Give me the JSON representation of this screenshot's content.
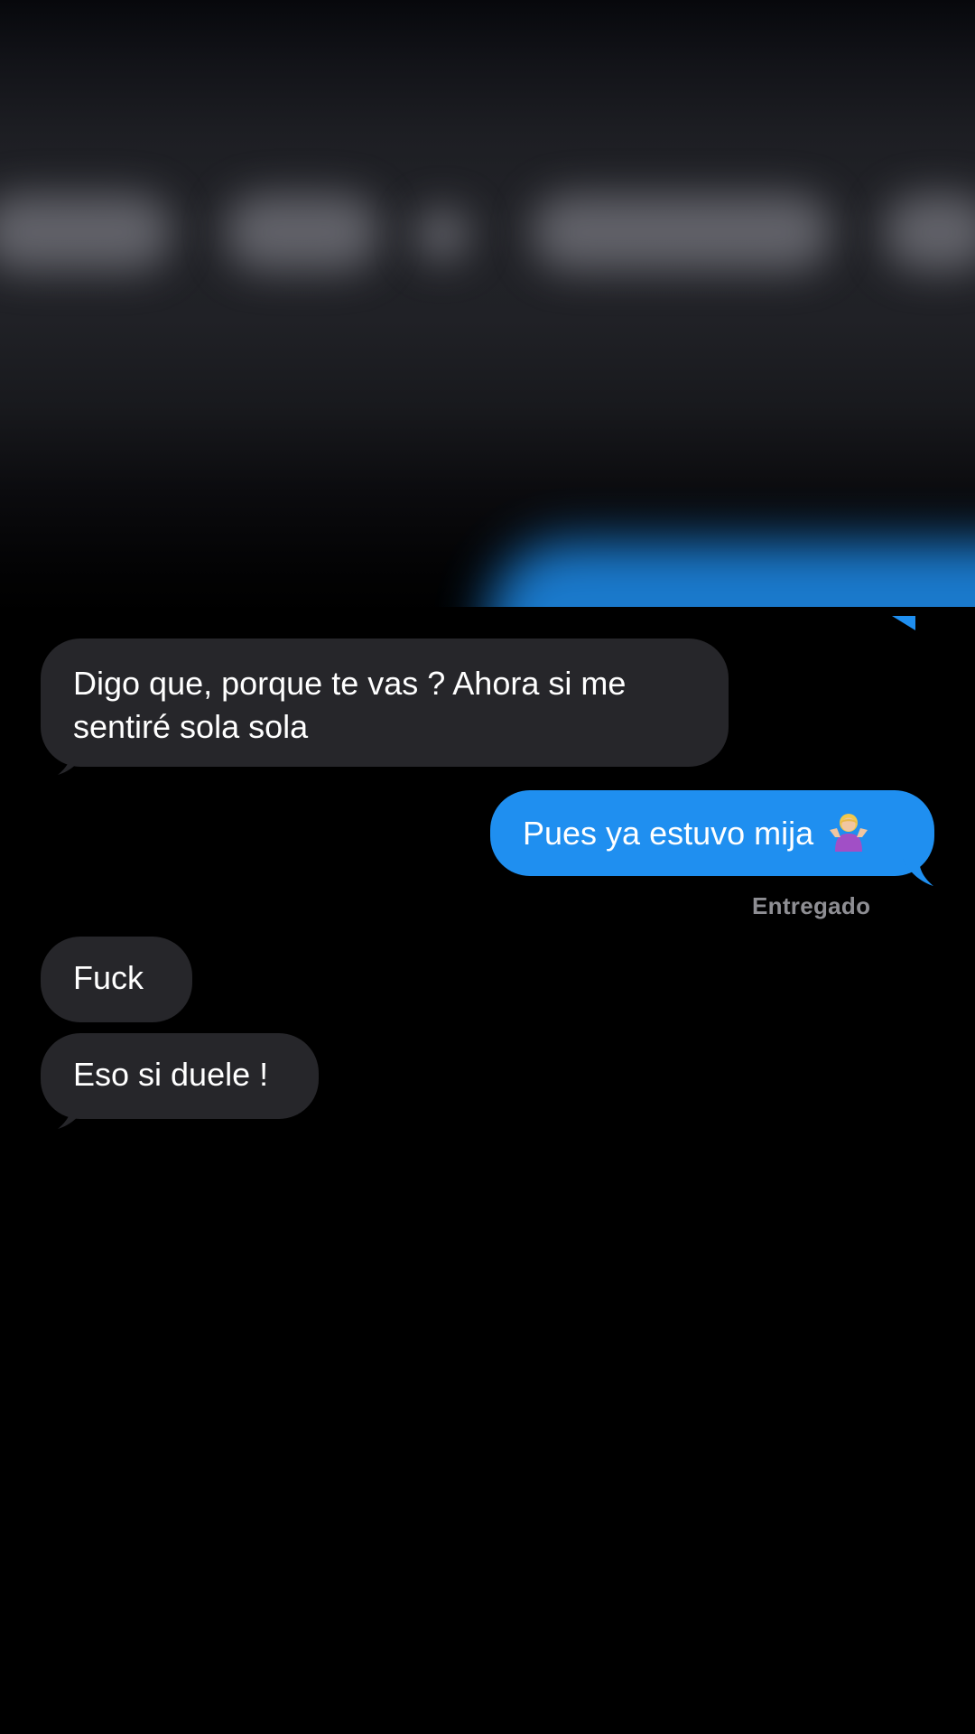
{
  "conversation": {
    "messages": [
      {
        "direction": "received",
        "text": "Digo que, porque te vas ? Ahora si me sentiré sola sola"
      },
      {
        "direction": "sent",
        "text": "Pues ya estuvo mija",
        "emoji": "person-shrugging-emoji"
      },
      {
        "direction": "received",
        "text": "Fuck"
      },
      {
        "direction": "received",
        "text": "Eso si duele !"
      }
    ],
    "delivery_status": "Entregado"
  },
  "colors": {
    "sent_bubble": "#1f8ff0",
    "received_bubble": "#26262a",
    "background": "#000000",
    "status_text": "#8e8e93"
  }
}
